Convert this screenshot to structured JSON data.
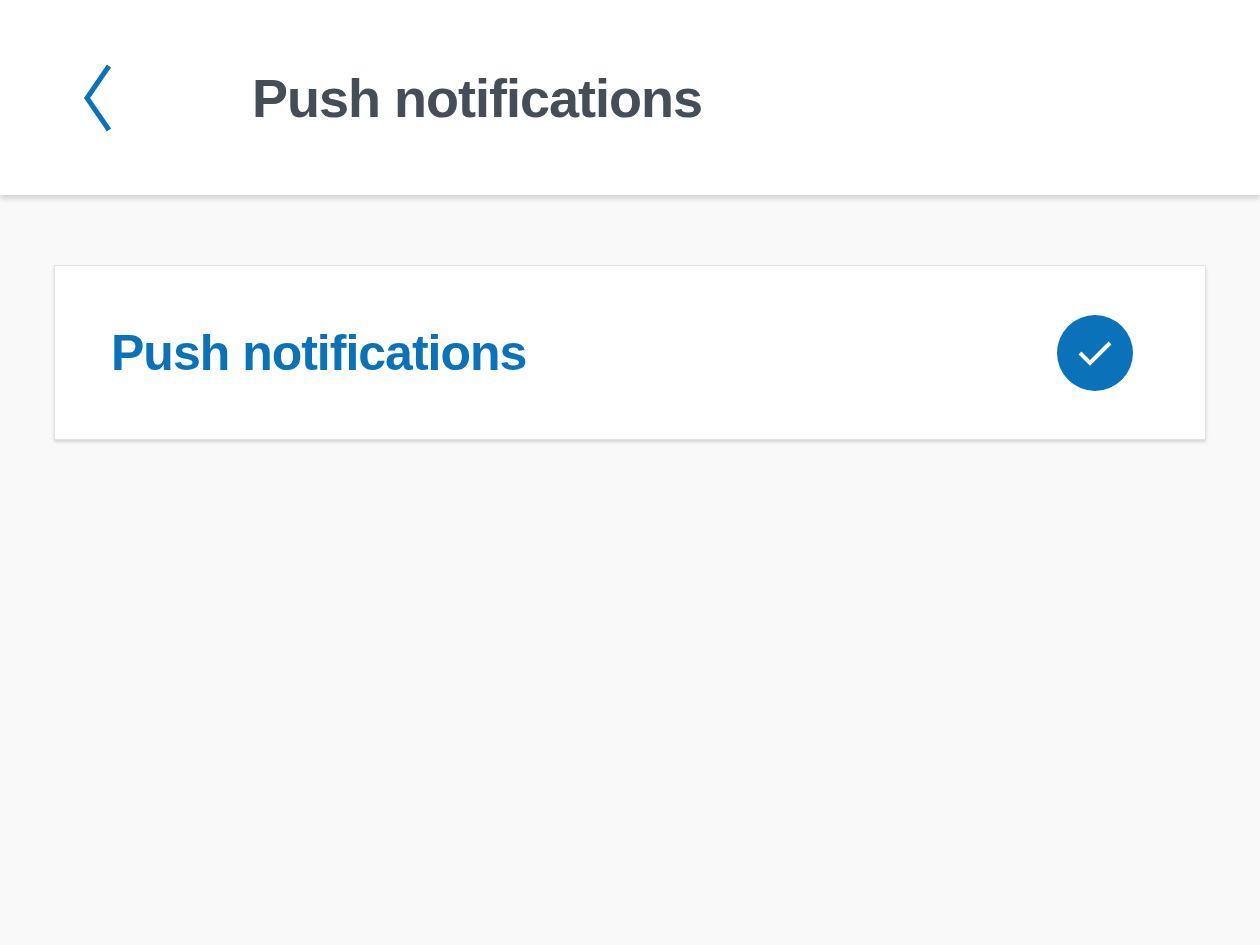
{
  "header": {
    "title": "Push notifications"
  },
  "settings": [
    {
      "kind": "check",
      "label": "Push notifications",
      "checked": true
    }
  ]
}
